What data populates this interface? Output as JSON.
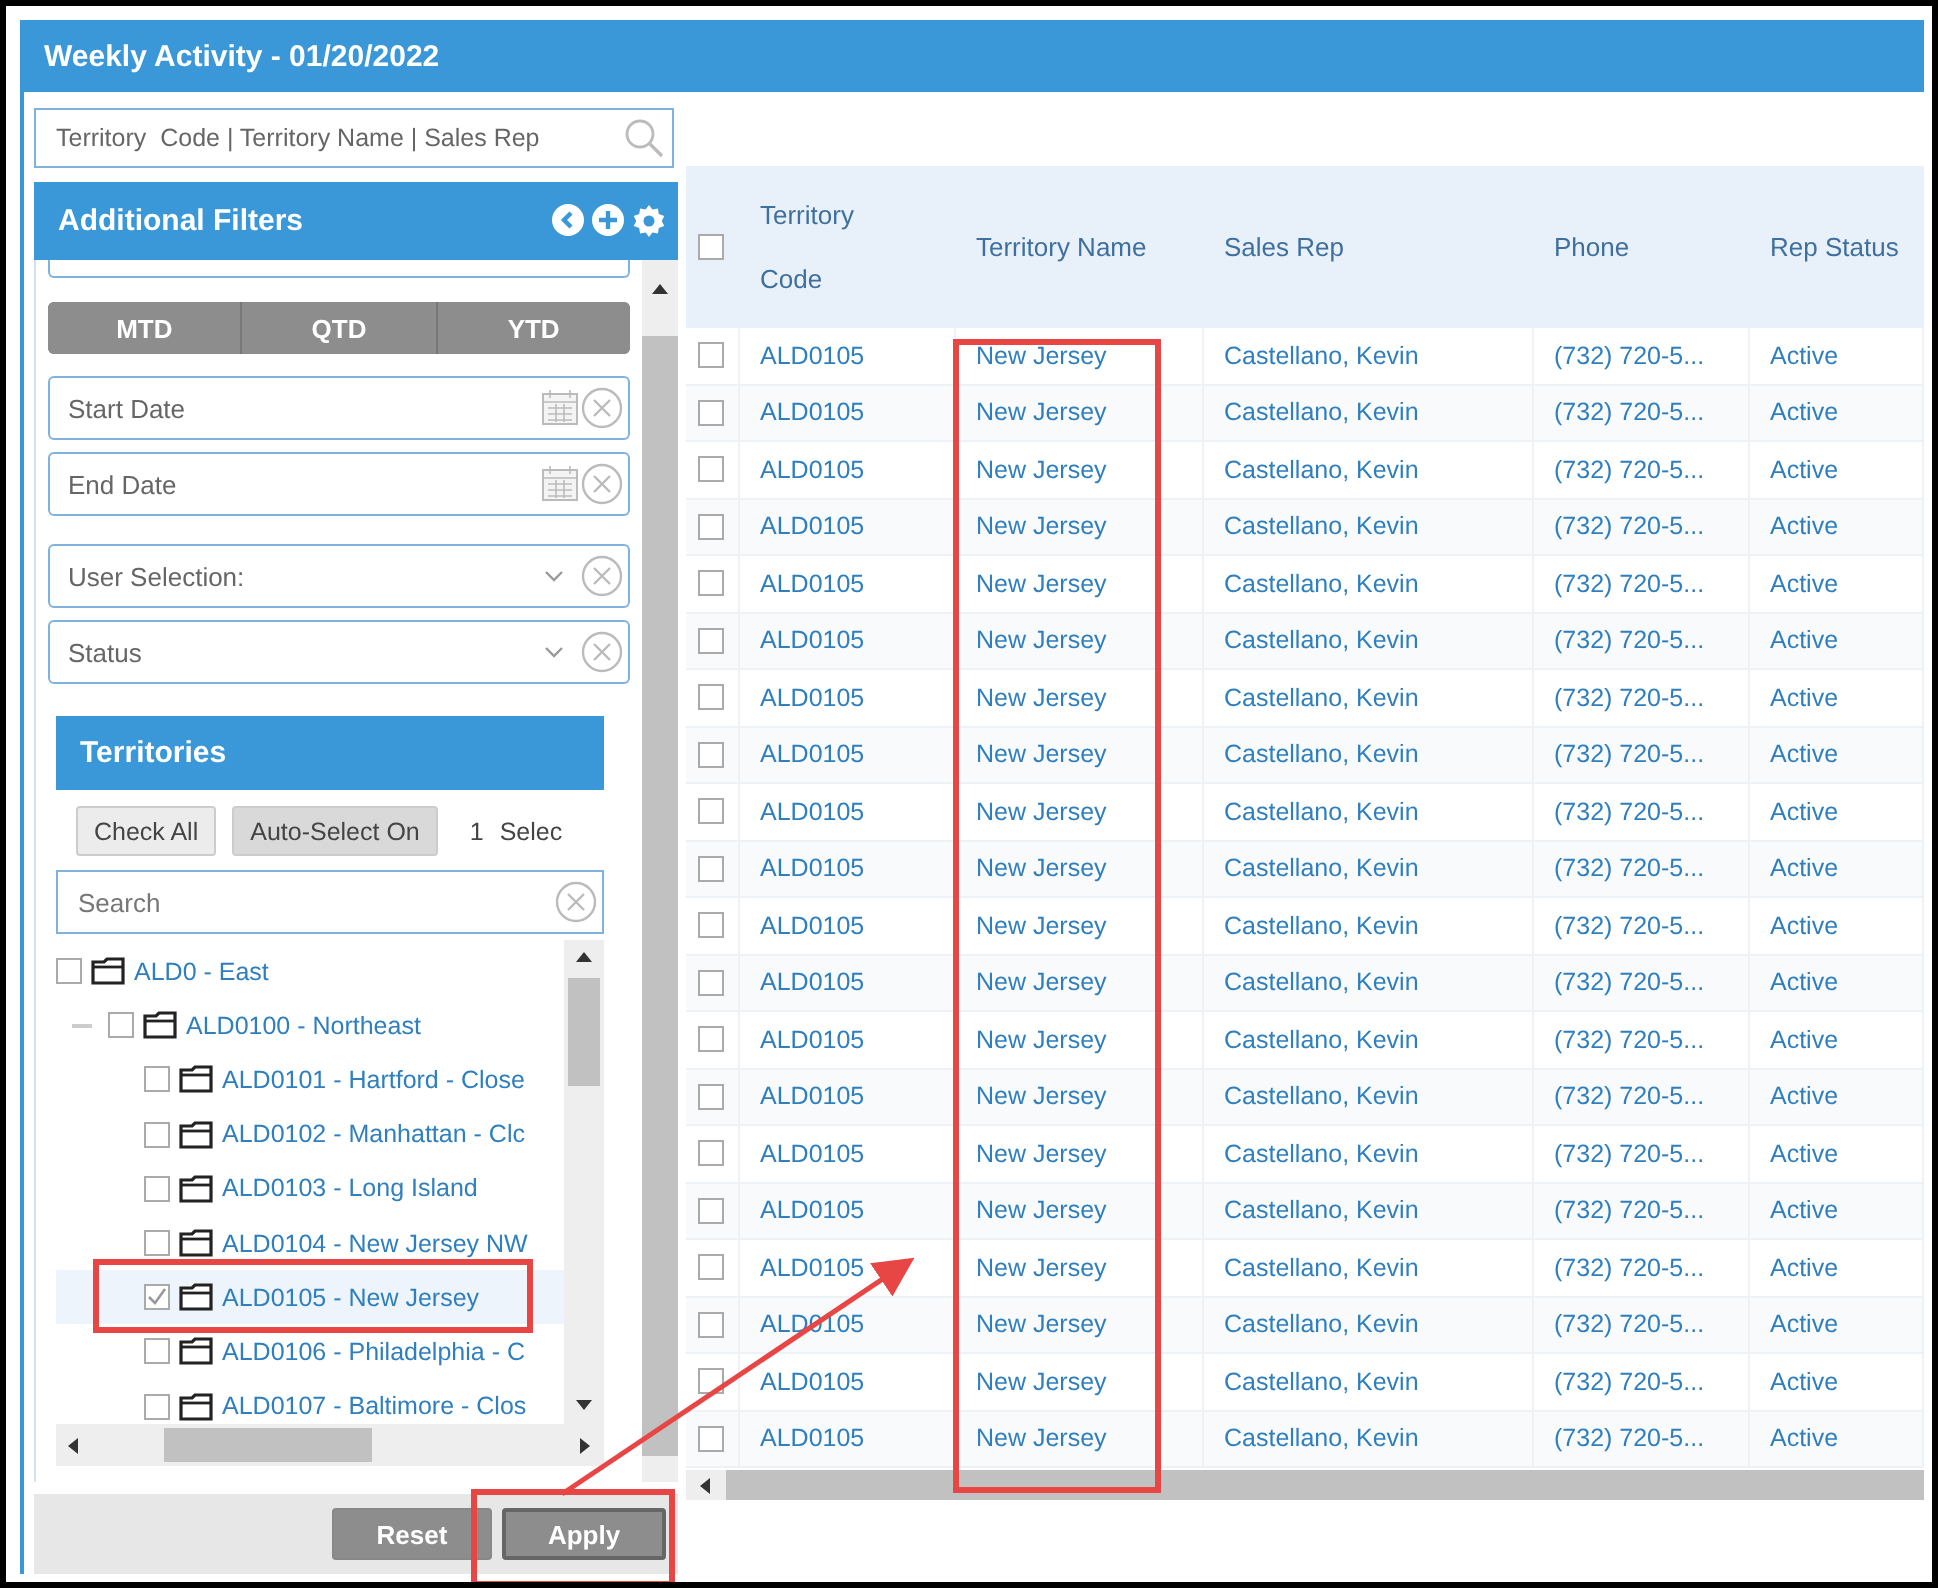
{
  "window": {
    "title": "Weekly Activity - 01/20/2022"
  },
  "search": {
    "placeholder": "Territory  Code | Territory Name | Sales Rep"
  },
  "filters": {
    "title": "Additional Filters",
    "periods": [
      "MTD",
      "QTD",
      "YTD"
    ],
    "fields": [
      {
        "kind": "date",
        "placeholder": "Start Date"
      },
      {
        "kind": "date",
        "placeholder": "End Date"
      },
      {
        "kind": "select",
        "placeholder": "User Selection:"
      },
      {
        "kind": "select",
        "placeholder": "Status"
      }
    ]
  },
  "territories": {
    "title": "Territories",
    "buttons": [
      "Check All",
      "Auto-Select On"
    ],
    "count": "1",
    "count_label": "Selec",
    "search_placeholder": "Search",
    "tree": [
      {
        "label": "ALD0 - East",
        "checked": false,
        "selected": false,
        "children": [
          {
            "label": "ALD0100 - Northeast",
            "checked": false,
            "selected": false,
            "expanded": true,
            "children": [
              {
                "label": "ALD0101 - Hartford - Close",
                "checked": false,
                "selected": false
              },
              {
                "label": "ALD0102 - Manhattan - Clc",
                "checked": false,
                "selected": false
              },
              {
                "label": "ALD0103 - Long Island",
                "checked": false,
                "selected": false
              },
              {
                "label": "ALD0104 - New Jersey NW",
                "checked": false,
                "selected": false
              },
              {
                "label": "ALD0105 - New Jersey",
                "checked": true,
                "selected": true
              },
              {
                "label": "ALD0106 - Philadelphia - C",
                "checked": false,
                "selected": false
              },
              {
                "label": "ALD0107 - Baltimore - Clos",
                "checked": false,
                "selected": false
              }
            ]
          }
        ]
      }
    ]
  },
  "actions": [
    "Reset",
    "Apply"
  ],
  "table": {
    "select_all": false,
    "columns": [
      "Territory Code",
      "Territory Name",
      "Sales Rep",
      "Phone",
      "Rep Status"
    ],
    "rows": [
      {
        "checked": false,
        "cells": [
          "ALD0105",
          "New Jersey",
          "Castellano, Kevin",
          "(732) 720-5...",
          "Active"
        ]
      },
      {
        "checked": false,
        "cells": [
          "ALD0105",
          "New Jersey",
          "Castellano, Kevin",
          "(732) 720-5...",
          "Active"
        ]
      },
      {
        "checked": false,
        "cells": [
          "ALD0105",
          "New Jersey",
          "Castellano, Kevin",
          "(732) 720-5...",
          "Active"
        ]
      },
      {
        "checked": false,
        "cells": [
          "ALD0105",
          "New Jersey",
          "Castellano, Kevin",
          "(732) 720-5...",
          "Active"
        ]
      },
      {
        "checked": false,
        "cells": [
          "ALD0105",
          "New Jersey",
          "Castellano, Kevin",
          "(732) 720-5...",
          "Active"
        ]
      },
      {
        "checked": false,
        "cells": [
          "ALD0105",
          "New Jersey",
          "Castellano, Kevin",
          "(732) 720-5...",
          "Active"
        ]
      },
      {
        "checked": false,
        "cells": [
          "ALD0105",
          "New Jersey",
          "Castellano, Kevin",
          "(732) 720-5...",
          "Active"
        ]
      },
      {
        "checked": false,
        "cells": [
          "ALD0105",
          "New Jersey",
          "Castellano, Kevin",
          "(732) 720-5...",
          "Active"
        ]
      },
      {
        "checked": false,
        "cells": [
          "ALD0105",
          "New Jersey",
          "Castellano, Kevin",
          "(732) 720-5...",
          "Active"
        ]
      },
      {
        "checked": false,
        "cells": [
          "ALD0105",
          "New Jersey",
          "Castellano, Kevin",
          "(732) 720-5...",
          "Active"
        ]
      },
      {
        "checked": false,
        "cells": [
          "ALD0105",
          "New Jersey",
          "Castellano, Kevin",
          "(732) 720-5...",
          "Active"
        ]
      },
      {
        "checked": false,
        "cells": [
          "ALD0105",
          "New Jersey",
          "Castellano, Kevin",
          "(732) 720-5...",
          "Active"
        ]
      },
      {
        "checked": false,
        "cells": [
          "ALD0105",
          "New Jersey",
          "Castellano, Kevin",
          "(732) 720-5...",
          "Active"
        ]
      },
      {
        "checked": false,
        "cells": [
          "ALD0105",
          "New Jersey",
          "Castellano, Kevin",
          "(732) 720-5...",
          "Active"
        ]
      },
      {
        "checked": false,
        "cells": [
          "ALD0105",
          "New Jersey",
          "Castellano, Kevin",
          "(732) 720-5...",
          "Active"
        ]
      },
      {
        "checked": false,
        "cells": [
          "ALD0105",
          "New Jersey",
          "Castellano, Kevin",
          "(732) 720-5...",
          "Active"
        ]
      },
      {
        "checked": false,
        "cells": [
          "ALD0105",
          "New Jersey",
          "Castellano, Kevin",
          "(732) 720-5...",
          "Active"
        ]
      },
      {
        "checked": false,
        "cells": [
          "ALD0105",
          "New Jersey",
          "Castellano, Kevin",
          "(732) 720-5...",
          "Active"
        ]
      },
      {
        "checked": false,
        "cells": [
          "ALD0105",
          "New Jersey",
          "Castellano, Kevin",
          "(732) 720-5...",
          "Active"
        ]
      },
      {
        "checked": false,
        "cells": [
          "ALD0105",
          "New Jersey",
          "Castellano, Kevin",
          "(732) 720-5...",
          "Active"
        ]
      }
    ]
  }
}
